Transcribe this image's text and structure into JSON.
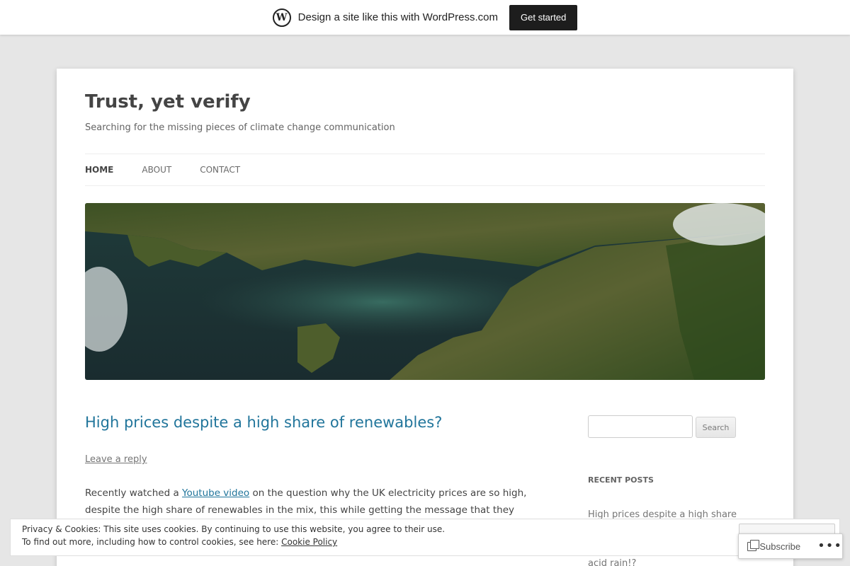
{
  "banner": {
    "logo": "W",
    "text": "Design a site like this with WordPress.com",
    "cta_label": "Get started"
  },
  "site": {
    "title": "Trust, yet verify",
    "description": "Searching for the missing pieces of climate change communication"
  },
  "nav": {
    "items": [
      {
        "label": "HOME"
      },
      {
        "label": "ABOUT"
      },
      {
        "label": "CONTACT"
      }
    ]
  },
  "post": {
    "title": "High prices despite a high share of renewables?",
    "leave_reply": "Leave a reply",
    "body_start": "Recently watched a ",
    "body_link": "Youtube video",
    "body_line1_end": " on the question why the UK electricity prices are so high,",
    "body_line2": "despite the high share of renewables in the mix, this while getting the message that they are so"
  },
  "sidebar": {
    "search_button": "Search",
    "recent_posts_title": "RECENT POSTS",
    "recent_posts": [
      "High prices despite a high share",
      "acid rain!?"
    ]
  },
  "cookie": {
    "line1": "Privacy & Cookies: This site uses cookies. By continuing to use this website, you agree to their use.",
    "line2_prefix": "To find out more, including how to control cookies, see here: ",
    "policy_link": "Cookie Policy"
  },
  "subscribe": {
    "label": "Subscribe",
    "more": "•••"
  },
  "icons": [
    "wordpress-logo-icon",
    "subscribe-icon",
    "more-icon"
  ]
}
